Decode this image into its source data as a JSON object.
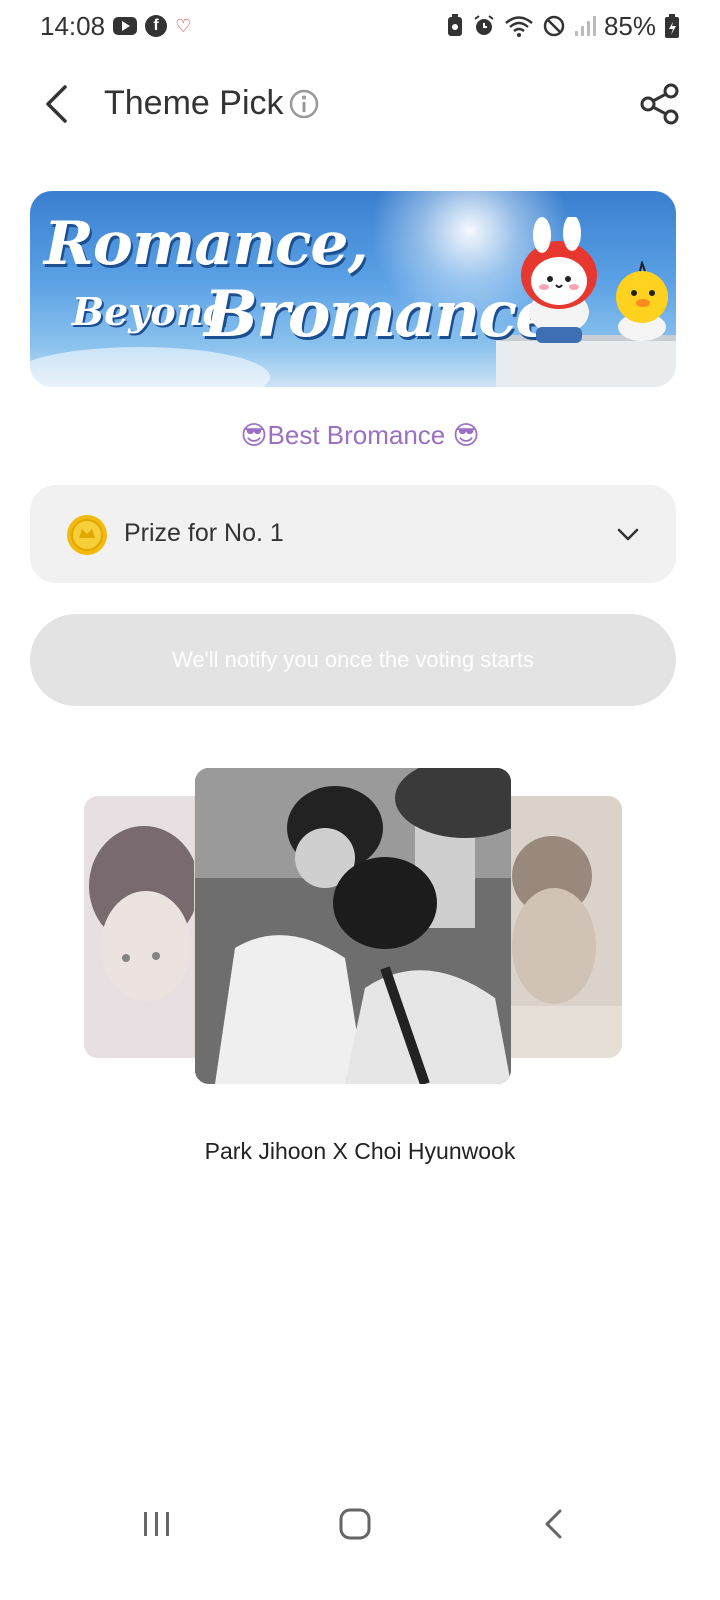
{
  "status_bar": {
    "time": "14:08",
    "battery": "85%"
  },
  "header": {
    "title": "Theme Pick"
  },
  "banner": {
    "line1": "Romance,",
    "line2": "Beyond",
    "line3": "Bromance"
  },
  "theme": {
    "subtitle": "😎Best Bromance 😎"
  },
  "prize": {
    "label": "Prize for No. 1"
  },
  "notify_button": {
    "label": "We'll notify you once the voting starts"
  },
  "carousel": {
    "current_pair": "Park Jihoon X Choi Hyunwook"
  },
  "colors": {
    "accent_purple": "#9b6fc2",
    "button_disabled_bg": "#e3e3e3",
    "prize_bg": "#f1f1f1",
    "coin": "#f2b90f"
  },
  "icons": [
    "youtube-icon",
    "facebook-icon",
    "hearts-icon",
    "battery-saver-icon",
    "alarm-icon",
    "wifi-icon",
    "do-not-disturb-icon",
    "signal-icon",
    "battery-icon",
    "back-arrow-icon",
    "info-icon",
    "share-icon",
    "coin-icon",
    "chevron-down-icon",
    "recents-icon",
    "home-icon",
    "nav-back-icon"
  ]
}
